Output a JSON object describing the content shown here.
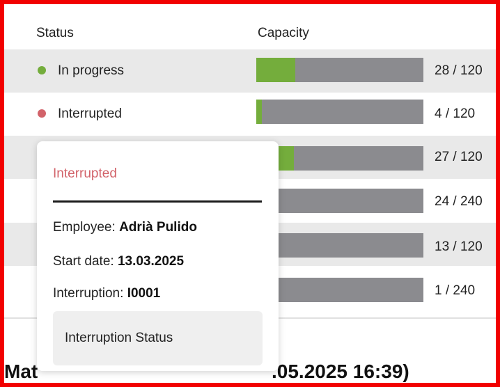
{
  "table": {
    "headers": {
      "status": "Status",
      "capacity": "Capacity"
    },
    "rows": [
      {
        "status": "In progress",
        "status_color": "#74ad3c",
        "used": 28,
        "total": 120,
        "capacity": "28 / 120"
      },
      {
        "status": "Interrupted",
        "status_color": "#d2636a",
        "used": 4,
        "total": 120,
        "capacity": "4 / 120"
      },
      {
        "status": "",
        "used": 27,
        "total": 120,
        "capacity": "27 / 120"
      },
      {
        "status": "",
        "used": 24,
        "total": 240,
        "capacity": "24 / 240"
      },
      {
        "status": "",
        "used": 13,
        "total": 120,
        "capacity": "13 / 120"
      },
      {
        "status": "",
        "used": 1,
        "total": 240,
        "capacity": "1 / 240"
      }
    ]
  },
  "popup": {
    "title": "Interrupted",
    "employee_label": "Employee:",
    "employee_value": "Adrià Pulido",
    "start_label": "Start date:",
    "start_value": "13.03.2025",
    "interruption_label": "Interruption:",
    "interruption_value": "I0001",
    "button_label": "Interruption Status"
  },
  "footer": {
    "left_text": "Mat",
    "right_text": ".05.2025 16:39)"
  },
  "colors": {
    "progress_fill": "#74ad3c",
    "bar_track": "#8b8b8f",
    "interrupted": "#d2636a",
    "row_shade": "#e9e9e9",
    "frame": "#f20000"
  }
}
